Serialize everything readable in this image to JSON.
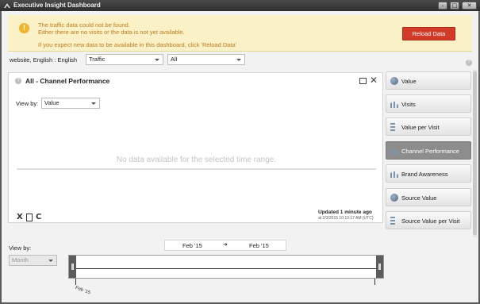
{
  "window": {
    "title": "Executive Insight Dashboard",
    "minimize": "–",
    "maximize": "□",
    "close": "✕"
  },
  "alert": {
    "icon": "!",
    "line1": "The traffic data could not be found.",
    "line2": "Either there are no visits or the data is not yet available.",
    "line3": "If you expect new data to be available in this dashboard, click 'Reload Data'",
    "button": "Reload Data"
  },
  "filters": {
    "scope": "website, English : English",
    "metric": "Traffic",
    "segment": "All",
    "help": "?"
  },
  "panel": {
    "help": "?",
    "title": "All - Channel Performance",
    "view_by_label": "View by:",
    "view_by_value": "Value",
    "empty_message": "No data available for the selected time range.",
    "tool_excel": "X",
    "tool_refresh": "C",
    "updated": "Updated 1 minute ago",
    "updated_detail": "at 2/3/2015 10:10:17 AM (UTC)"
  },
  "sidebar": {
    "items": [
      {
        "label": "Value",
        "icon": "pie-icon",
        "active": false
      },
      {
        "label": "Visits",
        "icon": "bar-chart-icon",
        "active": false
      },
      {
        "label": "Value per Visit",
        "icon": "horizontal-bar-icon",
        "active": false
      },
      {
        "label": "Channel Performance",
        "icon": "bar-chart-icon",
        "active": true
      },
      {
        "label": "Brand Awareness",
        "icon": "bar-chart-icon",
        "active": false
      },
      {
        "label": "Source Value",
        "icon": "pie-icon",
        "active": false
      },
      {
        "label": "Source Value per Visit",
        "icon": "horizontal-bar-icon",
        "active": false
      }
    ]
  },
  "timeline": {
    "start": "Feb '15",
    "arrow": "➔",
    "end": "Feb '15",
    "view_by_label": "View by:",
    "granularity": "Month",
    "tick_label": "Feb '15"
  }
}
